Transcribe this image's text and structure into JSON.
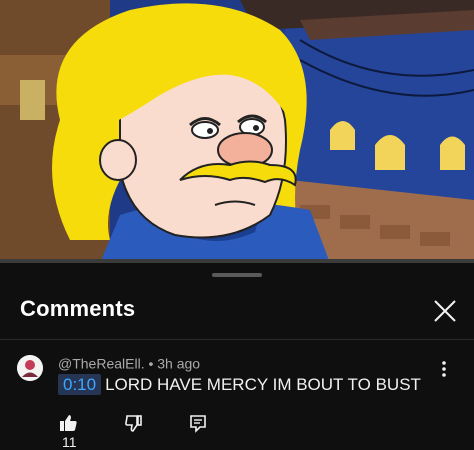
{
  "comments_panel": {
    "title": "Comments",
    "close_icon": "close-icon"
  },
  "comment": {
    "author": "@TheRealEll.",
    "separator": "•",
    "time": "3h ago",
    "timestamp": "0:10",
    "text": "LORD HAVE MERCY IM BOUT TO BUST",
    "likes": "11",
    "like_icon": "thumbs-up-icon",
    "dislike_icon": "thumbs-down-icon",
    "reply_icon": "reply-icon",
    "more_icon": "more-vert-icon"
  },
  "colors": {
    "background": "#0f0f0f",
    "timestamp_text": "#3ea6ff",
    "timestamp_bg": "#273554",
    "meta_text": "#aaaaaa"
  }
}
